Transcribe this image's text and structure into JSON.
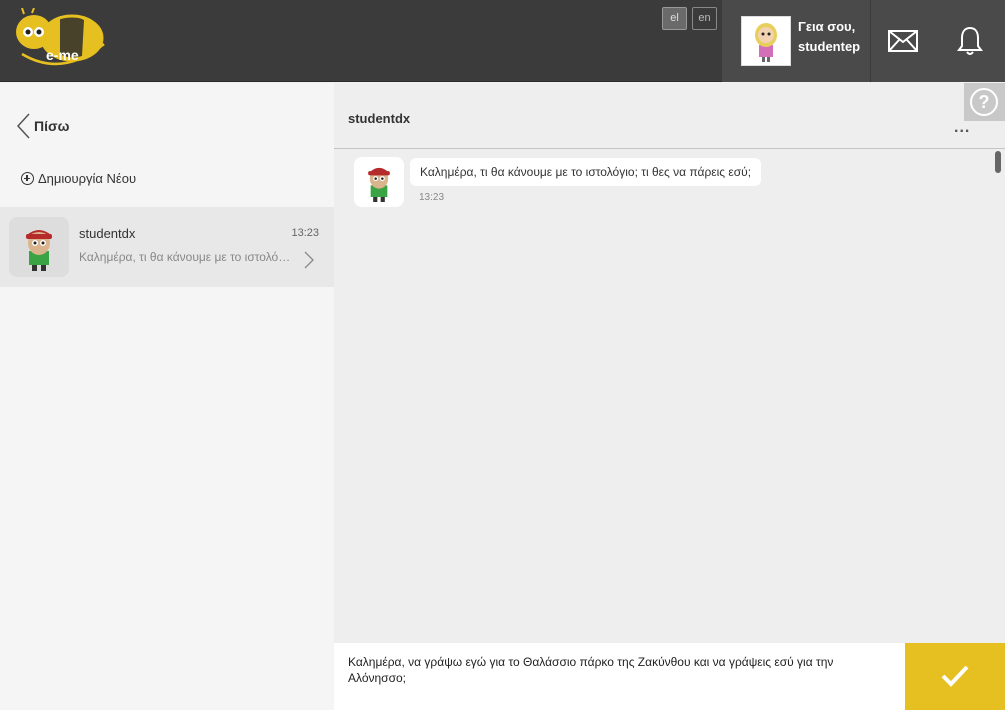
{
  "header": {
    "logo_text": "e-me",
    "languages": [
      {
        "code": "el",
        "active": true
      },
      {
        "code": "en",
        "active": false
      }
    ],
    "greeting_line1": "Γεια σου,",
    "greeting_line2": "studentep"
  },
  "sidebar": {
    "back_label": "Πίσω",
    "create_new_label": "Δημιουργία Νέου",
    "conversations": [
      {
        "name": "studentdx",
        "time": "13:23",
        "preview": "Καλημέρα, τι θα κάνουμε με το ιστολόγιο; τι θες να πάρεις εσύ;"
      }
    ]
  },
  "chat": {
    "title": "studentdx",
    "more_label": "...",
    "help_label": "?",
    "messages": [
      {
        "text": "Καλημέρα, τι θα κάνουμε με το ιστολόγιο; τι θες να πάρεις εσύ;",
        "time": "13:23"
      }
    ],
    "compose_text": " Καλημέρα, να γράψω εγώ για το Θαλάσσιο πάρκο της Ζακύνθου και να γράψεις εσύ για την Αλόνησσο;"
  },
  "colors": {
    "header_bg": "#3b3b3b",
    "accent_yellow": "#e6c021",
    "sidebar_bg": "#f5f5f5",
    "chat_bg": "#eeeeee"
  }
}
